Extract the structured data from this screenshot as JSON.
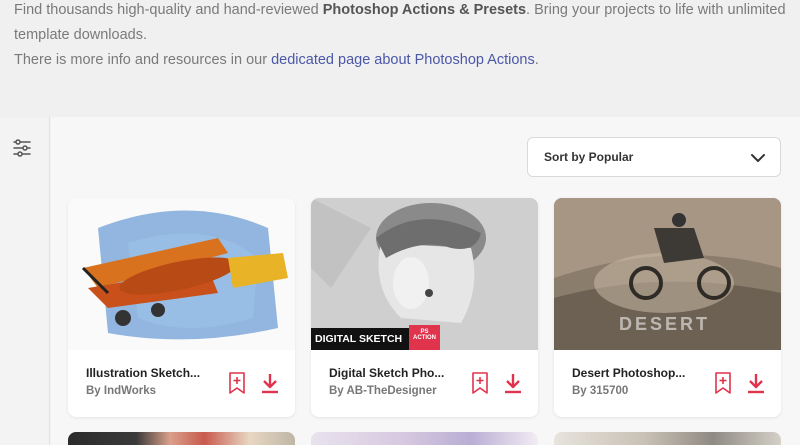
{
  "intro": {
    "line1_pre": "Find thousands high-quality and hand-reviewed ",
    "line1_bold": "Photoshop Actions & Presets",
    "line1_post": ". Bring your projects to life with unlimited template downloads.",
    "line2_pre": "There is more info and resources in our ",
    "line2_link": "dedicated page about Photoshop Actions",
    "line2_post": "."
  },
  "sort": {
    "label": "Sort by Popular"
  },
  "cards": [
    {
      "title": "Illustration Sketch...",
      "author": "By IndWorks"
    },
    {
      "title": "Digital Sketch Pho...",
      "author": "By AB-TheDesigner",
      "banner": "DIGITAL SKETCH",
      "badge_top": "PS",
      "badge_bottom": "ACTION"
    },
    {
      "title": "Desert Photoshop...",
      "author": "By 315700",
      "overlay": "DESERT"
    }
  ],
  "colors": {
    "accent": "#e0334c",
    "link": "#4b57a8"
  }
}
